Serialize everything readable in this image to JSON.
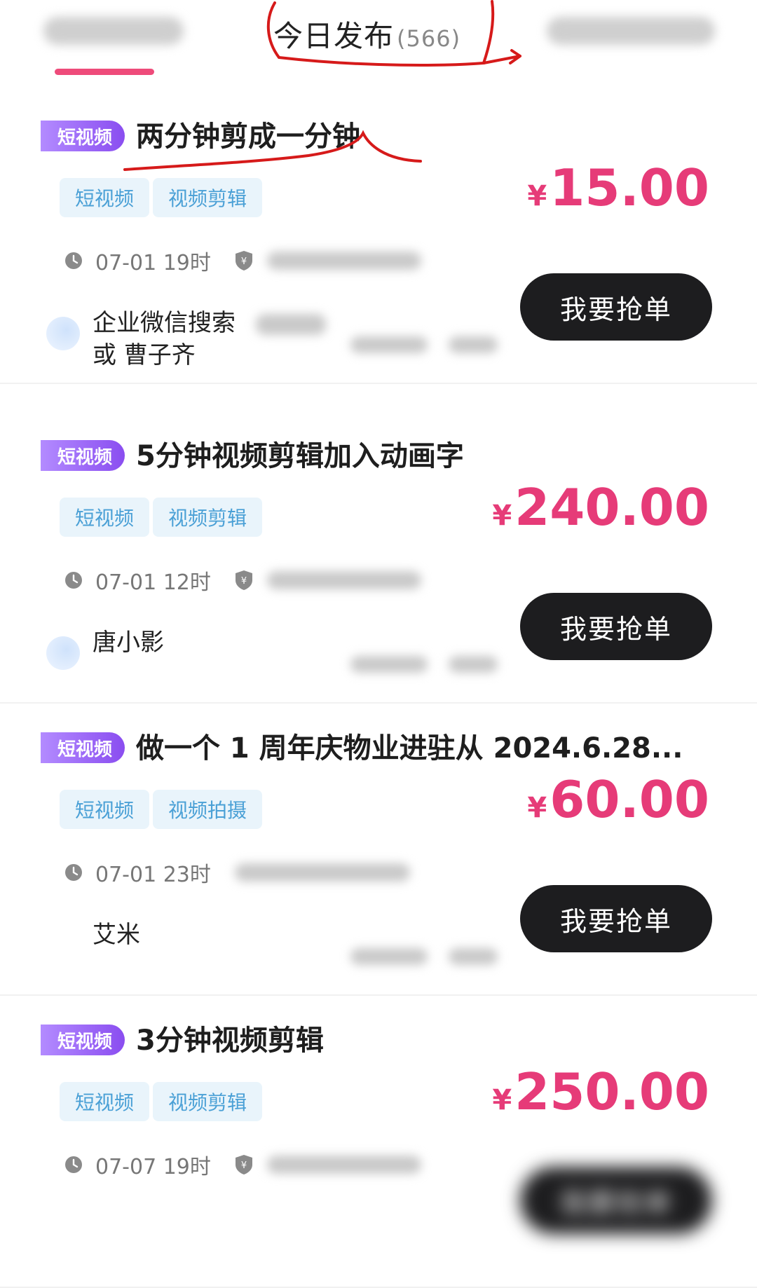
{
  "tabs": {
    "active_label": "今日发布",
    "active_count": "(566)"
  },
  "orders": [
    {
      "category": "短视频",
      "title": "两分钟剪成一分钟",
      "tags": [
        "短视频",
        "视频剪辑"
      ],
      "currency": "¥",
      "price": "15.00",
      "time": "07-01 19时",
      "publisher": "企业微信搜索或 曹子齐",
      "action": "我要抢单"
    },
    {
      "category": "短视频",
      "title": "5分钟视频剪辑加入动画字",
      "tags": [
        "短视频",
        "视频剪辑"
      ],
      "currency": "¥",
      "price": "240.00",
      "time": "07-01 12时",
      "publisher": "唐小影",
      "action": "我要抢单"
    },
    {
      "category": "短视频",
      "title": "做一个 1 周年庆物业进驻从 2024.6.28...",
      "tags": [
        "短视频",
        "视频拍摄"
      ],
      "currency": "¥",
      "price": "60.00",
      "time": "07-01 23时",
      "publisher": "艾米",
      "action": "我要抢单"
    },
    {
      "category": "短视频",
      "title": "3分钟视频剪辑",
      "tags": [
        "短视频",
        "视频剪辑"
      ],
      "currency": "¥",
      "price": "250.00",
      "time": "07-07 19时",
      "publisher": "",
      "action": "我要抢单"
    }
  ],
  "colors": {
    "accent_pink": "#e63b78",
    "tab_indicator": "#ee4b7a",
    "badge_purple": "#8a4df0",
    "tag_bg": "#e9f4fb",
    "tag_text": "#4aa0d6",
    "button_dark": "#1d1d1f",
    "annotation_red": "#d61a1a"
  },
  "icons": {
    "time": "clock-icon",
    "guarantee": "shield-yen-icon"
  }
}
